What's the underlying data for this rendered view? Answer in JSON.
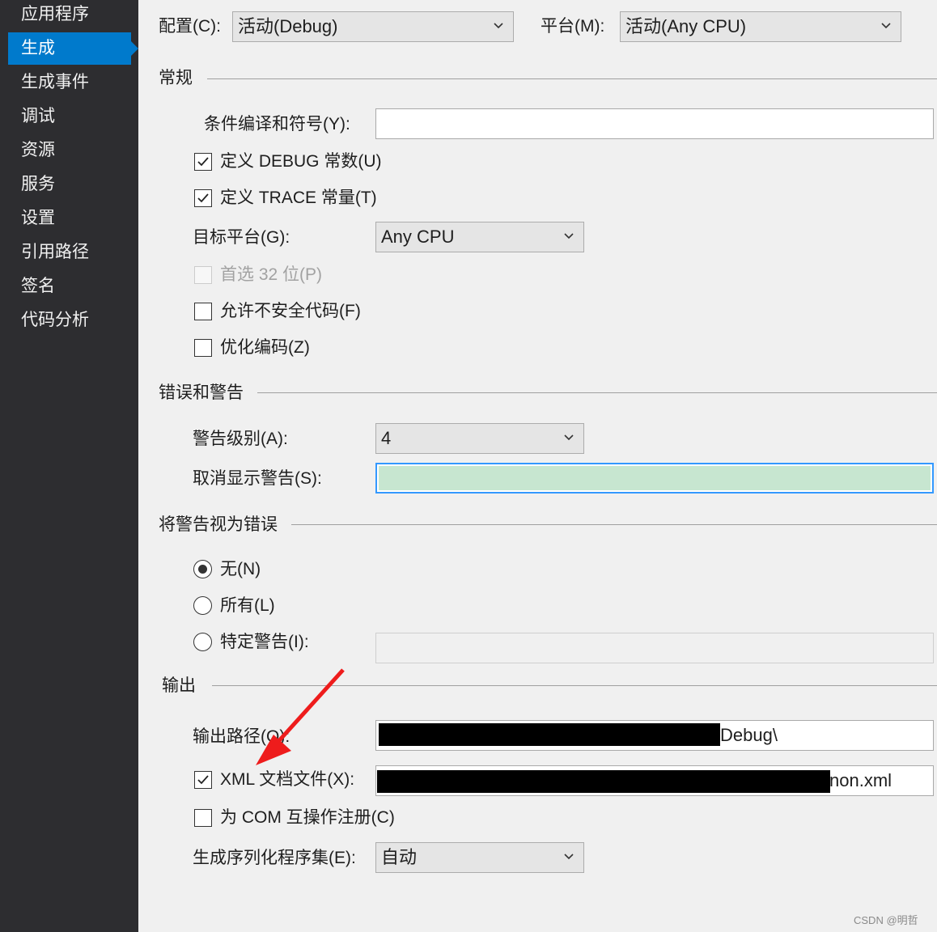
{
  "sidebar": {
    "items": [
      {
        "label": "应用程序",
        "active": false
      },
      {
        "label": "生成",
        "active": true
      },
      {
        "label": "生成事件",
        "active": false
      },
      {
        "label": "调试",
        "active": false
      },
      {
        "label": "资源",
        "active": false
      },
      {
        "label": "服务",
        "active": false
      },
      {
        "label": "设置",
        "active": false
      },
      {
        "label": "引用路径",
        "active": false
      },
      {
        "label": "签名",
        "active": false
      },
      {
        "label": "代码分析",
        "active": false
      }
    ]
  },
  "config": {
    "config_label": "配置(C):",
    "config_value": "活动(Debug)",
    "platform_label": "平台(M):",
    "platform_value": "活动(Any CPU)"
  },
  "general": {
    "title": "常规",
    "conditional_label": "条件编译和符号(Y):",
    "conditional_value": "",
    "define_debug_label": "定义 DEBUG 常数(U)",
    "define_debug_checked": true,
    "define_trace_label": "定义 TRACE 常量(T)",
    "define_trace_checked": true,
    "target_platform_label": "目标平台(G):",
    "target_platform_value": "Any CPU",
    "prefer32_label": "首选 32 位(P)",
    "prefer32_checked": false,
    "unsafe_label": "允许不安全代码(F)",
    "unsafe_checked": false,
    "optimize_label": "优化编码(Z)",
    "optimize_checked": false
  },
  "errors": {
    "title": "错误和警告",
    "warning_level_label": "警告级别(A):",
    "warning_level_value": "4",
    "suppress_label": "取消显示警告(S):",
    "suppress_value": ""
  },
  "treat_warnings": {
    "title": "将警告视为错误",
    "none_label": "无(N)",
    "all_label": "所有(L)",
    "specific_label": "特定警告(I):",
    "selected": "none",
    "specific_value": ""
  },
  "output": {
    "title": "输出",
    "path_label": "输出路径(O):",
    "path_value_visible": "Debug\\",
    "xml_label": "XML 文档文件(X):",
    "xml_checked": true,
    "xml_value_visible": "non.xml",
    "com_label": "为 COM 互操作注册(C)",
    "com_checked": false,
    "serialization_label": "生成序列化程序集(E):",
    "serialization_value": "自动"
  },
  "watermark": "CSDN @明哲"
}
